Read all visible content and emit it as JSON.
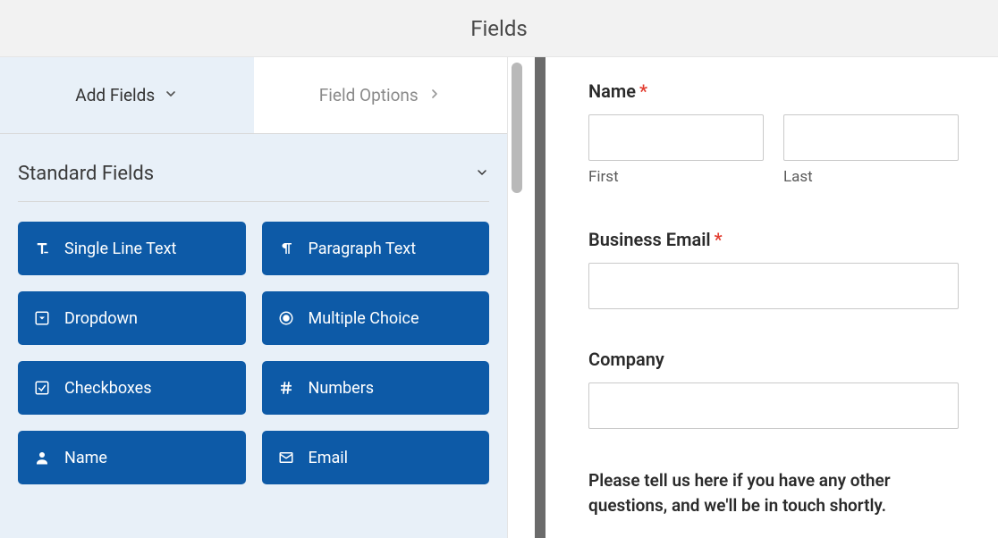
{
  "header": {
    "title": "Fields"
  },
  "tabs": {
    "add": "Add Fields",
    "options": "Field Options"
  },
  "section": {
    "title": "Standard Fields"
  },
  "field_buttons": {
    "single_line": "Single Line Text",
    "paragraph": "Paragraph Text",
    "dropdown": "Dropdown",
    "multiple": "Multiple Choice",
    "checkboxes": "Checkboxes",
    "numbers": "Numbers",
    "name": "Name",
    "email": "Email"
  },
  "preview": {
    "name_label": "Name",
    "first_sub": "First",
    "last_sub": "Last",
    "email_label": "Business Email",
    "company_label": "Company",
    "prompt": "Please tell us here if you have any other questions, and we'll be in touch shortly."
  },
  "required_marker": "*"
}
